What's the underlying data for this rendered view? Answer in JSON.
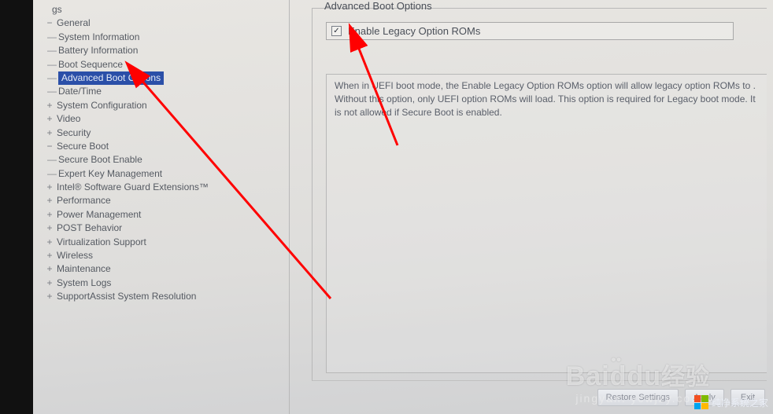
{
  "sidebar": {
    "partial_top": "gs",
    "items": [
      {
        "label": "General",
        "glyph": "−",
        "children": [
          {
            "label": "System Information"
          },
          {
            "label": "Battery Information"
          },
          {
            "label": "Boot Sequence"
          },
          {
            "label": "Advanced Boot Options",
            "selected": true
          },
          {
            "label": "Date/Time"
          }
        ]
      },
      {
        "label": "System Configuration",
        "glyph": "+"
      },
      {
        "label": "Video",
        "glyph": "+"
      },
      {
        "label": "Security",
        "glyph": "+"
      },
      {
        "label": "Secure Boot",
        "glyph": "−",
        "children": [
          {
            "label": "Secure Boot Enable"
          },
          {
            "label": "Expert Key Management"
          }
        ]
      },
      {
        "label": "Intel® Software Guard Extensions™",
        "glyph": "+"
      },
      {
        "label": "Performance",
        "glyph": "+"
      },
      {
        "label": "Power Management",
        "glyph": "+"
      },
      {
        "label": "POST Behavior",
        "glyph": "+"
      },
      {
        "label": "Virtualization Support",
        "glyph": "+"
      },
      {
        "label": "Wireless",
        "glyph": "+"
      },
      {
        "label": "Maintenance",
        "glyph": "+"
      },
      {
        "label": "System Logs",
        "glyph": "+"
      },
      {
        "label": "SupportAssist System Resolution",
        "glyph": "+"
      }
    ]
  },
  "right": {
    "fieldset_title": "Advanced Boot Options",
    "checkbox_label": "Enable Legacy Option ROMs",
    "checkbox_checked": "✓",
    "description": "When in UEFI boot mode, the Enable Legacy Option ROMs option will allow legacy option ROMs to . Without this option, only UEFI option ROMs will load. This option is required for Legacy boot mode. It is not allowed if Secure Boot is enabled."
  },
  "buttons": {
    "restore": "Restore Settings",
    "apply": "Apply",
    "exit": "Exit"
  },
  "watermarks": {
    "baidu_latin": "Bai",
    "baidu_du": "du",
    "baidu_cn": "经验",
    "baidu_sub": "jingyan.         ycwjzy.com",
    "cj_text": "纯净系统之家"
  }
}
